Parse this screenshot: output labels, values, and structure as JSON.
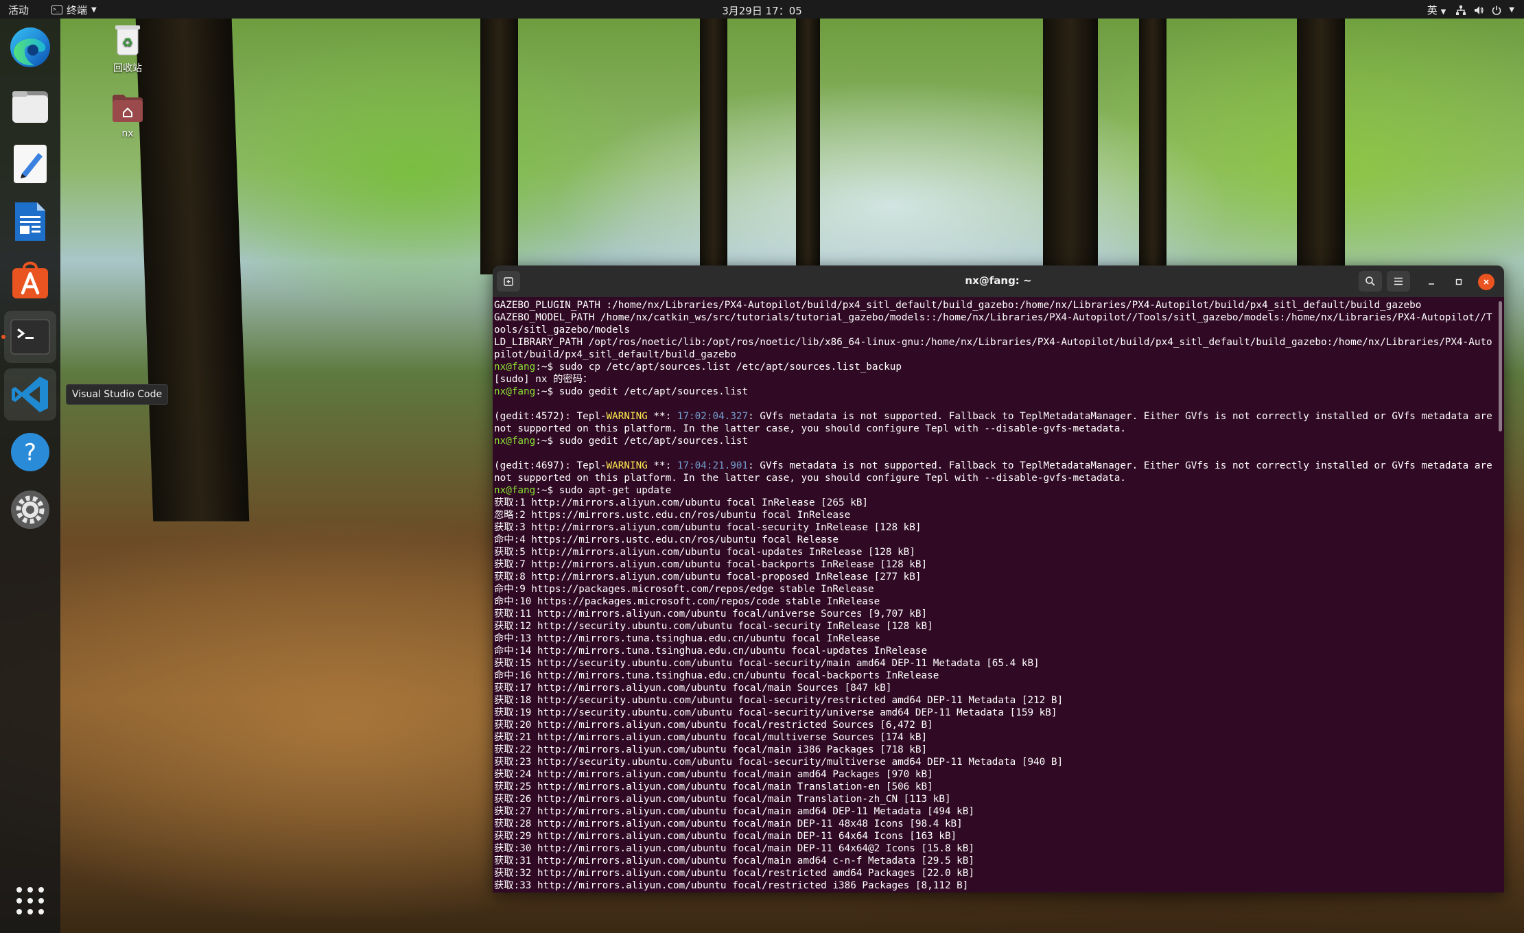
{
  "topbar": {
    "activities": "活动",
    "app_menu": "终端",
    "clock": "3月29日 17：05",
    "input_method": "英"
  },
  "dock": {
    "tooltip": "Visual Studio Code",
    "items": [
      {
        "name": "microsoft-edge",
        "icon": "edge-icon"
      },
      {
        "name": "files",
        "icon": "files-icon"
      },
      {
        "name": "text-editor",
        "icon": "text-editor-icon"
      },
      {
        "name": "libreoffice-writer",
        "icon": "writer-icon"
      },
      {
        "name": "ubuntu-software",
        "icon": "software-icon"
      },
      {
        "name": "terminal",
        "icon": "terminal-icon"
      },
      {
        "name": "visual-studio-code",
        "icon": "vscode-icon"
      },
      {
        "name": "help",
        "icon": "help-icon"
      },
      {
        "name": "settings",
        "icon": "settings-icon"
      },
      {
        "name": "show-applications",
        "icon": "app-grid-icon"
      }
    ]
  },
  "desktop": {
    "trash_label": "回收站",
    "home_label": "nx"
  },
  "terminal": {
    "title": "nx@fang: ~",
    "lines": [
      {
        "text": "GAZEBO_PLUGIN_PATH :/home/nx/Libraries/PX4-Autopilot/build/px4_sitl_default/build_gazebo:/home/nx/Libraries/PX4-Autopilot/build/px4_sitl_default/build_gazebo"
      },
      {
        "text": "GAZEBO_MODEL_PATH /home/nx/catkin_ws/src/tutorials/tutorial_gazebo/models::/home/nx/Libraries/PX4-Autopilot//Tools/sitl_gazebo/models:/home/nx/Libraries/PX4-Autopilot//Tools/sitl_gazebo/models"
      },
      {
        "text": "LD_LIBRARY_PATH /opt/ros/noetic/lib:/opt/ros/noetic/lib/x86_64-linux-gnu:/home/nx/Libraries/PX4-Autopilot/build/px4_sitl_default/build_gazebo:/home/nx/Libraries/PX4-Autopilot/build/px4_sitl_default/build_gazebo"
      },
      {
        "prompt": "nx@fang",
        "path": ":~$",
        "text": " sudo cp /etc/apt/sources.list /etc/apt/sources.list_backup"
      },
      {
        "text": "[sudo] nx 的密码："
      },
      {
        "prompt": "nx@fang",
        "path": ":~$",
        "text": " sudo gedit /etc/apt/sources.list"
      },
      {
        "text": ""
      },
      {
        "pre": "(gedit:4572): Tepl-",
        "warn": "WARNING",
        "mid": " **: ",
        "ts": "17:02:04.327",
        "text": ": GVfs metadata is not supported. Fallback to TeplMetadataManager. Either GVfs is not correctly installed or GVfs metadata are not supported on this platform. In the latter case, you should configure Tepl with --disable-gvfs-metadata."
      },
      {
        "prompt": "nx@fang",
        "path": ":~$",
        "text": " sudo gedit /etc/apt/sources.list"
      },
      {
        "text": ""
      },
      {
        "pre": "(gedit:4697): Tepl-",
        "warn": "WARNING",
        "mid": " **: ",
        "ts": "17:04:21.901",
        "text": ": GVfs metadata is not supported. Fallback to TeplMetadataManager. Either GVfs is not correctly installed or GVfs metadata are not supported on this platform. In the latter case, you should configure Tepl with --disable-gvfs-metadata."
      },
      {
        "prompt": "nx@fang",
        "path": ":~$",
        "text": " sudo apt-get update"
      },
      {
        "text": "获取:1 http://mirrors.aliyun.com/ubuntu focal InRelease [265 kB]"
      },
      {
        "text": "忽略:2 https://mirrors.ustc.edu.cn/ros/ubuntu focal InRelease"
      },
      {
        "text": "获取:3 http://mirrors.aliyun.com/ubuntu focal-security InRelease [128 kB]"
      },
      {
        "text": "命中:4 https://mirrors.ustc.edu.cn/ros/ubuntu focal Release"
      },
      {
        "text": "获取:5 http://mirrors.aliyun.com/ubuntu focal-updates InRelease [128 kB]"
      },
      {
        "text": "获取:7 http://mirrors.aliyun.com/ubuntu focal-backports InRelease [128 kB]"
      },
      {
        "text": "获取:8 http://mirrors.aliyun.com/ubuntu focal-proposed InRelease [277 kB]"
      },
      {
        "text": "命中:9 https://packages.microsoft.com/repos/edge stable InRelease"
      },
      {
        "text": "命中:10 https://packages.microsoft.com/repos/code stable InRelease"
      },
      {
        "text": "获取:11 http://mirrors.aliyun.com/ubuntu focal/universe Sources [9,707 kB]"
      },
      {
        "text": "获取:12 http://security.ubuntu.com/ubuntu focal-security InRelease [128 kB]"
      },
      {
        "text": "命中:13 http://mirrors.tuna.tsinghua.edu.cn/ubuntu focal InRelease"
      },
      {
        "text": "命中:14 http://mirrors.tuna.tsinghua.edu.cn/ubuntu focal-updates InRelease"
      },
      {
        "text": "获取:15 http://security.ubuntu.com/ubuntu focal-security/main amd64 DEP-11 Metadata [65.4 kB]"
      },
      {
        "text": "命中:16 http://mirrors.tuna.tsinghua.edu.cn/ubuntu focal-backports InRelease"
      },
      {
        "text": "获取:17 http://mirrors.aliyun.com/ubuntu focal/main Sources [847 kB]"
      },
      {
        "text": "获取:18 http://security.ubuntu.com/ubuntu focal-security/restricted amd64 DEP-11 Metadata [212 B]"
      },
      {
        "text": "获取:19 http://security.ubuntu.com/ubuntu focal-security/universe amd64 DEP-11 Metadata [159 kB]"
      },
      {
        "text": "获取:20 http://mirrors.aliyun.com/ubuntu focal/restricted Sources [6,472 B]"
      },
      {
        "text": "获取:21 http://mirrors.aliyun.com/ubuntu focal/multiverse Sources [174 kB]"
      },
      {
        "text": "获取:22 http://mirrors.aliyun.com/ubuntu focal/main i386 Packages [718 kB]"
      },
      {
        "text": "获取:23 http://security.ubuntu.com/ubuntu focal-security/multiverse amd64 DEP-11 Metadata [940 B]"
      },
      {
        "text": "获取:24 http://mirrors.aliyun.com/ubuntu focal/main amd64 Packages [970 kB]"
      },
      {
        "text": "获取:25 http://mirrors.aliyun.com/ubuntu focal/main Translation-en [506 kB]"
      },
      {
        "text": "获取:26 http://mirrors.aliyun.com/ubuntu focal/main Translation-zh_CN [113 kB]"
      },
      {
        "text": "获取:27 http://mirrors.aliyun.com/ubuntu focal/main amd64 DEP-11 Metadata [494 kB]"
      },
      {
        "text": "获取:28 http://mirrors.aliyun.com/ubuntu focal/main DEP-11 48x48 Icons [98.4 kB]"
      },
      {
        "text": "获取:29 http://mirrors.aliyun.com/ubuntu focal/main DEP-11 64x64 Icons [163 kB]"
      },
      {
        "text": "获取:30 http://mirrors.aliyun.com/ubuntu focal/main DEP-11 64x64@2 Icons [15.8 kB]"
      },
      {
        "text": "获取:31 http://mirrors.aliyun.com/ubuntu focal/main amd64 c-n-f Metadata [29.5 kB]"
      },
      {
        "text": "获取:32 http://mirrors.aliyun.com/ubuntu focal/restricted amd64 Packages [22.0 kB]"
      },
      {
        "text": "获取:33 http://mirrors.aliyun.com/ubuntu focal/restricted i386 Packages [8,112 B]"
      }
    ]
  },
  "colors": {
    "terminal_bg": "#300a24",
    "prompt": "#8ae234",
    "warning": "#fce94f",
    "timestamp": "#729fcf",
    "close_button": "#e95420"
  }
}
